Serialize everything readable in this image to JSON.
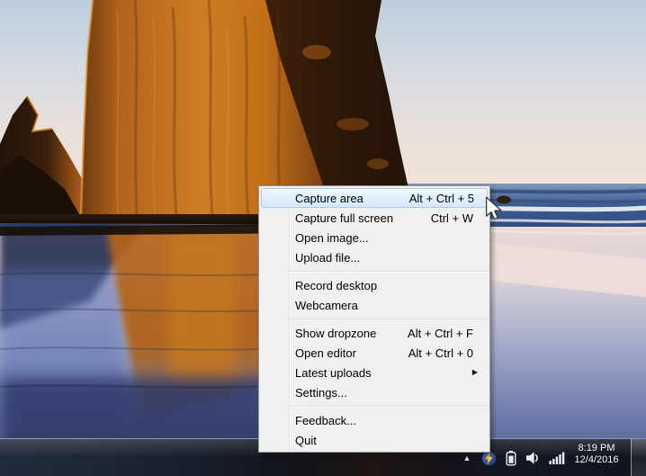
{
  "tray_menu": {
    "items": [
      {
        "type": "item",
        "label": "Capture area",
        "shortcut": "Alt + Ctrl + 5",
        "highlighted": true
      },
      {
        "type": "item",
        "label": "Capture full screen",
        "shortcut": "Ctrl + W"
      },
      {
        "type": "item",
        "label": "Open image..."
      },
      {
        "type": "item",
        "label": "Upload file..."
      },
      {
        "type": "separator"
      },
      {
        "type": "item",
        "label": "Record desktop"
      },
      {
        "type": "item",
        "label": "Webcamera"
      },
      {
        "type": "separator"
      },
      {
        "type": "item",
        "label": "Show dropzone",
        "shortcut": "Alt + Ctrl + F"
      },
      {
        "type": "item",
        "label": "Open editor",
        "shortcut": "Alt + Ctrl + 0"
      },
      {
        "type": "item",
        "label": "Latest uploads",
        "submenu": true
      },
      {
        "type": "item",
        "label": "Settings..."
      },
      {
        "type": "separator"
      },
      {
        "type": "item",
        "label": "Feedback..."
      },
      {
        "type": "item",
        "label": "Quit"
      }
    ],
    "submenu_arrow_glyph": "▶"
  },
  "taskbar": {
    "hidden_icons_glyph": "▲",
    "tray_icons": [
      {
        "name": "lightning-app-icon",
        "glyph": "lightning-bolt-in-blue-circle"
      },
      {
        "name": "battery-icon",
        "glyph": "battery"
      },
      {
        "name": "volume-icon",
        "glyph": "speaker"
      },
      {
        "name": "network-icon",
        "glyph": "signal-bars"
      }
    ],
    "clock": {
      "time": "8:19 PM",
      "date": "12/4/2016"
    }
  },
  "colors": {
    "menu_bg": "#f0f0f0",
    "menu_highlight_fill": "#dcebfb",
    "menu_highlight_border": "#a9c9ea",
    "taskbar_bg": "#141824",
    "clock_text": "#ffffff",
    "lightning_yellow": "#ffd34d",
    "tray_icon_white": "#ececec"
  }
}
